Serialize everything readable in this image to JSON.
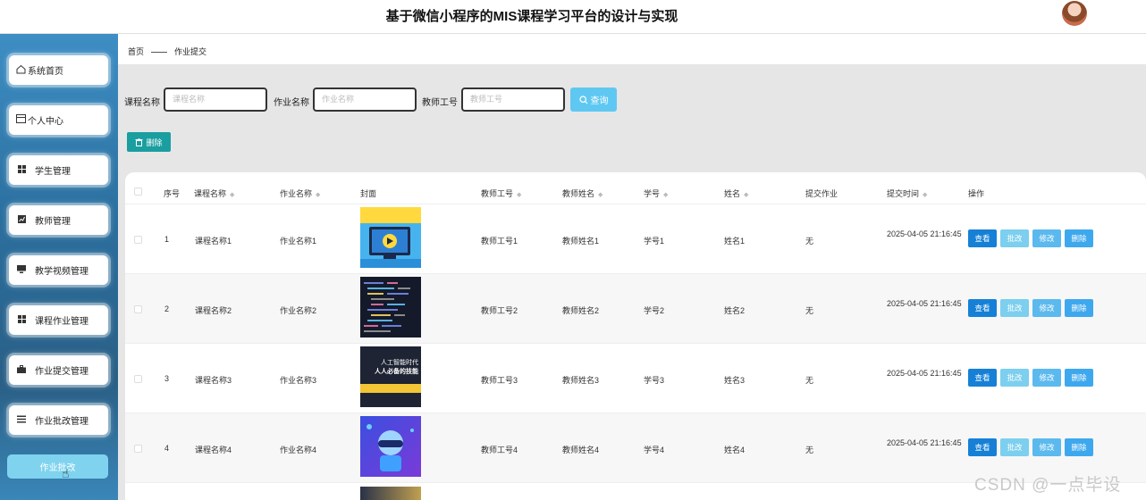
{
  "header": {
    "title": "基于微信小程序的MIS课程学习平台的设计与实现"
  },
  "sidebar": {
    "items": [
      {
        "label": "系统首页",
        "icon": "home-icon"
      },
      {
        "label": "个人中心",
        "icon": "profile-icon"
      },
      {
        "label": "学生管理",
        "icon": "grid-icon"
      },
      {
        "label": "教师管理",
        "icon": "chart-icon"
      },
      {
        "label": "教学视频管理",
        "icon": "monitor-icon"
      },
      {
        "label": "课程作业管理",
        "icon": "grid-icon"
      },
      {
        "label": "作业提交管理",
        "icon": "briefcase-icon"
      },
      {
        "label": "作业批改管理",
        "icon": "list-icon"
      }
    ],
    "sub_item": "作业批改"
  },
  "breadcrumb": {
    "home": "首页",
    "current": "作业提交"
  },
  "search": {
    "course_label": "课程名称",
    "course_placeholder": "课程名称",
    "homework_label": "作业名称",
    "homework_placeholder": "作业名称",
    "teacher_label": "教师工号",
    "teacher_placeholder": "教师工号",
    "query_label": "查询"
  },
  "toolbar": {
    "delete_label": "删除"
  },
  "table": {
    "columns": [
      "序号",
      "课程名称",
      "作业名称",
      "封面",
      "教师工号",
      "教师姓名",
      "学号",
      "姓名",
      "提交作业",
      "提交时间",
      "操作"
    ],
    "rows": [
      {
        "no": "1",
        "course": "课程名称1",
        "homework": "作业名称1",
        "teacher_id": "教师工号1",
        "teacher_name": "教师姓名1",
        "student_id": "学号1",
        "name": "姓名1",
        "submitted": "无",
        "time": "2025-04-05 21:16:45"
      },
      {
        "no": "2",
        "course": "课程名称2",
        "homework": "作业名称2",
        "teacher_id": "教师工号2",
        "teacher_name": "教师姓名2",
        "student_id": "学号2",
        "name": "姓名2",
        "submitted": "无",
        "time": "2025-04-05 21:16:45"
      },
      {
        "no": "3",
        "course": "课程名称3",
        "homework": "作业名称3",
        "teacher_id": "教师工号3",
        "teacher_name": "教师姓名3",
        "student_id": "学号3",
        "name": "姓名3",
        "submitted": "无",
        "time": "2025-04-05 21:16:45"
      },
      {
        "no": "4",
        "course": "课程名称4",
        "homework": "作业名称4",
        "teacher_id": "教师工号4",
        "teacher_name": "教师姓名4",
        "student_id": "学号4",
        "name": "姓名4",
        "submitted": "无",
        "time": "2025-04-05 21:16:45"
      }
    ],
    "actions": {
      "view": "查看",
      "grade": "批改",
      "edit": "修改",
      "delete": "删除"
    }
  },
  "covers": {
    "cover3_line1": "人工智能时代",
    "cover3_line2": "人人必备的技能"
  },
  "watermark": "CSDN @一点毕设"
}
